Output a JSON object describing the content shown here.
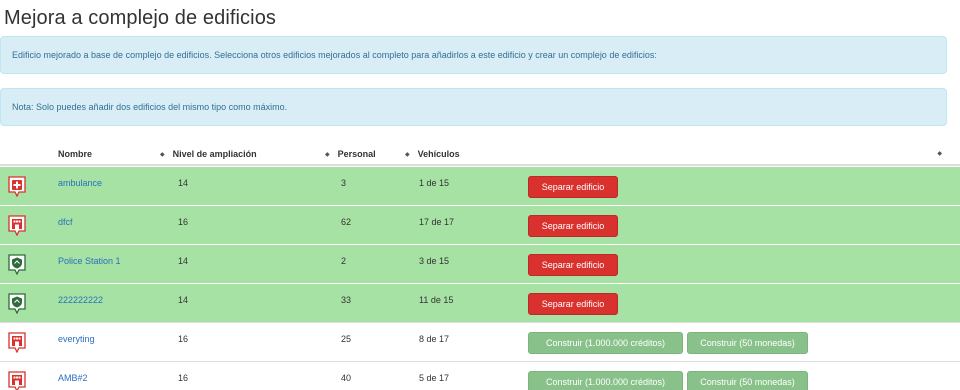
{
  "page": {
    "title": "Mejora a complejo de edificios",
    "info_text": "Edificio mejorado a base de complejo de edificios. Selecciona otros edificios mejorados al completo para añadirlos a este edificio y crear un complejo de edificios:",
    "note_text": "Nota: Solo puedes añadir dos edificios del mismo tipo como máximo."
  },
  "table": {
    "columns": {
      "name": "Nombre",
      "level": "Nivel de ampliación",
      "staff": "Personal",
      "vehicles": "Vehículos"
    },
    "sort_glyph": "◆",
    "rows": [
      {
        "name": "ambulance",
        "level": "14",
        "staff": "3",
        "vehicles": "1 de 15",
        "status": "joined",
        "icon": "hospital-cross-icon",
        "action": "Separar edificio"
      },
      {
        "name": "dfcf",
        "level": "16",
        "staff": "62",
        "vehicles": "17 de 17",
        "status": "joined",
        "icon": "fire-station-icon",
        "action": "Separar edificio"
      },
      {
        "name": "Police Station 1",
        "level": "14",
        "staff": "2",
        "vehicles": "3 de 15",
        "status": "joined",
        "icon": "police-shield-icon",
        "action": "Separar edificio"
      },
      {
        "name": "222222222",
        "level": "14",
        "staff": "33",
        "vehicles": "11 de 15",
        "status": "joined",
        "icon": "police-shield-icon",
        "action": "Separar edificio"
      },
      {
        "name": "everyting",
        "level": "16",
        "staff": "25",
        "vehicles": "8 de 17",
        "status": "available",
        "icon": "fire-station-icon",
        "action_credits": "Construir (1.000.000 créditos)",
        "action_coins": "Construir (50 monedas)"
      },
      {
        "name": "AMB#2",
        "level": "16",
        "staff": "40",
        "vehicles": "5 de 17",
        "status": "available",
        "icon": "fire-station-icon",
        "action_credits": "Construir (1.000.000 créditos)",
        "action_coins": "Construir (50 monedas)"
      }
    ]
  },
  "colors": {
    "joined_row": "#a6e2a3",
    "danger_button": "#d9312e",
    "success_button": "#88c28a",
    "alert_background": "#d9edf7",
    "link": "#2a6fbf"
  }
}
